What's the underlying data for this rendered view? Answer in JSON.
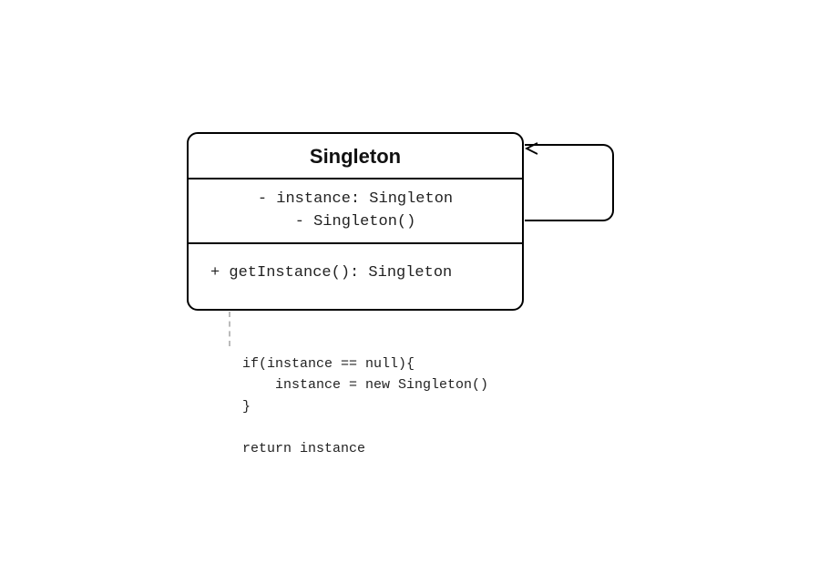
{
  "class": {
    "name": "Singleton",
    "attributes": [
      "- instance: Singleton",
      "-  Singleton()"
    ],
    "methods": [
      "+ getInstance(): Singleton"
    ]
  },
  "note": {
    "code": "if(instance == null){\n    instance = new Singleton()\n}\n\nreturn instance"
  }
}
